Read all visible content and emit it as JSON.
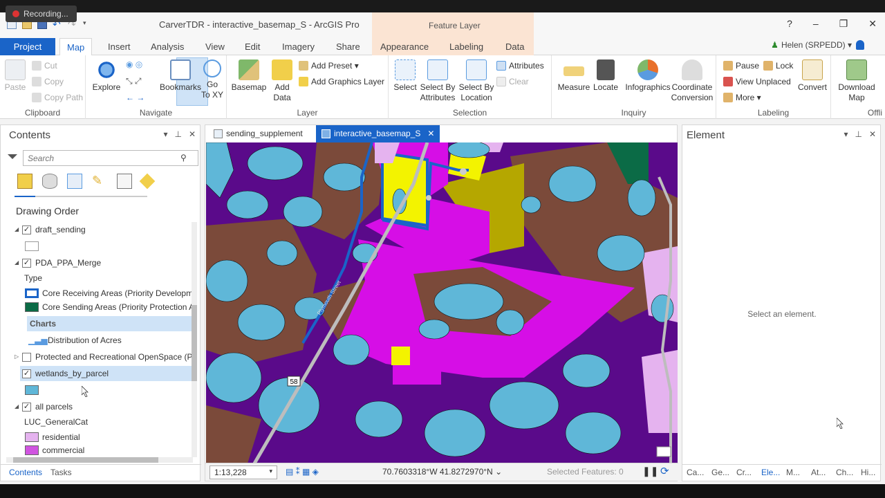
{
  "recording": "Recording...",
  "window": {
    "title": "CarverTDR - interactive_basemap_S - ArcGIS Pro",
    "context_tab": "Feature Layer",
    "user": "Helen (SRPEDD)",
    "help": "?",
    "minimize": "–",
    "restore": "❐",
    "close": "✕"
  },
  "tabs": [
    "Project",
    "Map",
    "Insert",
    "Analysis",
    "View",
    "Edit",
    "Imagery",
    "Share",
    "Appearance",
    "Labeling",
    "Data"
  ],
  "ribbon": {
    "clipboard": {
      "label": "Clipboard",
      "paste": "Paste",
      "cut": "Cut",
      "copy": "Copy",
      "copy_path": "Copy Path"
    },
    "navigate": {
      "label": "Navigate",
      "explore": "Explore",
      "bookmarks": "Bookmarks",
      "goto": "Go\nTo XY"
    },
    "layer": {
      "label": "Layer",
      "basemap": "Basemap",
      "add_data": "Add\nData",
      "add_preset": "Add Preset",
      "add_graphics": "Add Graphics Layer"
    },
    "selection": {
      "label": "Selection",
      "select": "Select",
      "select_by_attributes": "Select By\nAttributes",
      "select_by_location": "Select By\nLocation",
      "attributes": "Attributes",
      "clear": "Clear"
    },
    "inquiry": {
      "label": "Inquiry",
      "measure": "Measure",
      "locate": "Locate",
      "infographics": "Infographics",
      "coord_conv": "Coordinate\nConversion"
    },
    "labeling": {
      "label": "Labeling",
      "pause": "Pause",
      "lock": "Lock",
      "view_unplaced": "View Unplaced",
      "more": "More",
      "convert": "Convert"
    },
    "offline": {
      "label": "Offli",
      "download_map": "Download\nMap"
    }
  },
  "contents": {
    "title": "Contents",
    "search_placeholder": "Search",
    "drawing_order": "Drawing Order",
    "layers": {
      "draft_sending": "draft_sending",
      "pda_ppa": "PDA_PPA_Merge",
      "type": "Type",
      "core_receiving": "Core Receiving Areas (Priority Development",
      "core_sending": "Core Sending Areas (Priority Protection A",
      "charts": "Charts",
      "distribution": "Distribution of Acres",
      "protected": "Protected and Recreational OpenSpace (Pol",
      "wetlands": "wetlands_by_parcel",
      "all_parcels": "all parcels",
      "luc": "LUC_GeneralCat",
      "residential": "residential",
      "commercial": "commercial"
    },
    "tab_contents": "Contents",
    "tab_tasks": "Tasks"
  },
  "map": {
    "tab1": "sending_supplement",
    "tab2": "interactive_basemap_S",
    "scale": "1:13,228",
    "coords": "70.7603318°W 41.8272970°N",
    "selected_features": "Selected Features: 0",
    "road_label": "58",
    "street_label": "Plymouth Street"
  },
  "element": {
    "title": "Element",
    "message": "Select an element.",
    "tabs": [
      "Ca...",
      "Ge...",
      "Cr...",
      "Ele...",
      "M...",
      "At...",
      "Ch...",
      "Hi..."
    ]
  },
  "colors": {
    "water": "#5fb7d8",
    "brown": "#7b4a3a",
    "purple": "#5a0a8a",
    "magenta": "#d60ee6",
    "yellow": "#f3f300",
    "olive": "#b5a700",
    "green": "#0b6b46",
    "accent": "#1a64c8",
    "residential": "#e5b3ef",
    "commercial": "#d054e0"
  }
}
